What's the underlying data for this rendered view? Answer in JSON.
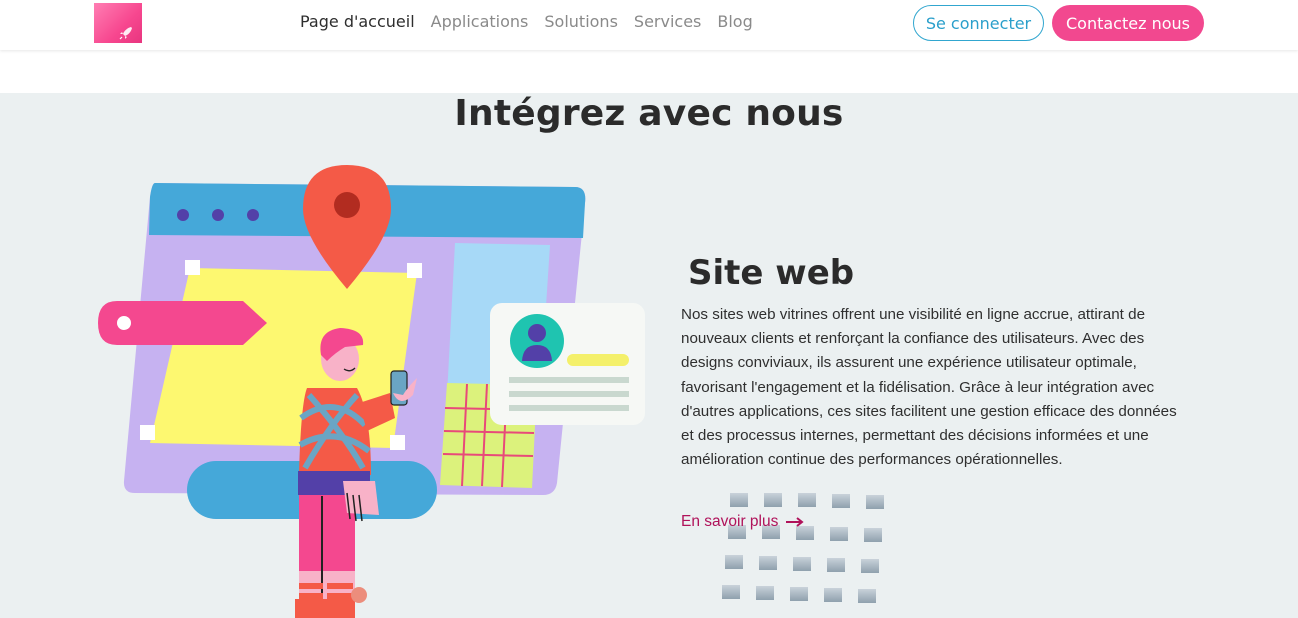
{
  "header": {
    "logo": "rocket-logo",
    "nav": [
      {
        "label": "Page d'accueil",
        "active": true
      },
      {
        "label": "Applications",
        "active": false
      },
      {
        "label": "Solutions",
        "active": false
      },
      {
        "label": "Services",
        "active": false
      },
      {
        "label": "Blog",
        "active": false
      }
    ],
    "login_label": "Se connecter",
    "contact_label": "Contactez nous"
  },
  "section": {
    "title": "Intégrez avec nous",
    "card": {
      "title": "Site web",
      "text": "Nos sites web vitrines offrent une visibilité en ligne accrue, attirant de nouveaux clients et renforçant la confiance des utilisateurs. Avec des designs conviviaux, ils assurent une expérience utilisateur optimale, favorisant l'engagement et la fidélisation. Grâce à leur intégration avec d'autres applications, ces sites facilitent une gestion efficace des données et des processus internes, permettant des décisions informées et une amélioration continue des performances opérationnelles.",
      "link_label": "En savoir plus",
      "link_icon": "arrow-right-icon"
    }
  },
  "colors": {
    "brand_pink": "#f2488f",
    "brand_blue": "#31a6cf",
    "link_crimson": "#b0125a",
    "section_bg": "#ebf0f1"
  }
}
